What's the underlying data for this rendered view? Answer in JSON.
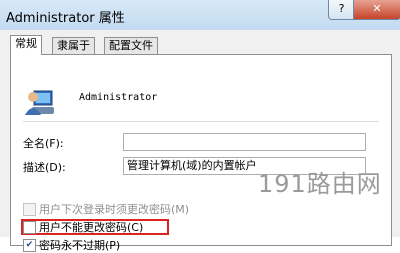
{
  "window": {
    "title": "Administrator 属性",
    "help_label": "?",
    "close_label": "✕"
  },
  "tabs": [
    {
      "label": "常规",
      "active": true
    },
    {
      "label": "隶属于",
      "active": false
    },
    {
      "label": "配置文件",
      "active": false
    }
  ],
  "general": {
    "avatar_icon": "user-account-icon",
    "username": "Administrator",
    "fullname_label": "全名(F):",
    "fullname_value": "",
    "description_label": "描述(D):",
    "description_value": "管理计算机(域)的内置帐户",
    "checkboxes": [
      {
        "label": "用户下次登录时须更改密码(M)",
        "checked": false,
        "enabled": false
      },
      {
        "label": "用户不能更改密码(C)",
        "checked": false,
        "enabled": true
      },
      {
        "label": "密码永不过期(P)",
        "checked": true,
        "enabled": true
      }
    ]
  },
  "colors": {
    "highlight_border": "#dd2222"
  },
  "watermark": "191路由网"
}
